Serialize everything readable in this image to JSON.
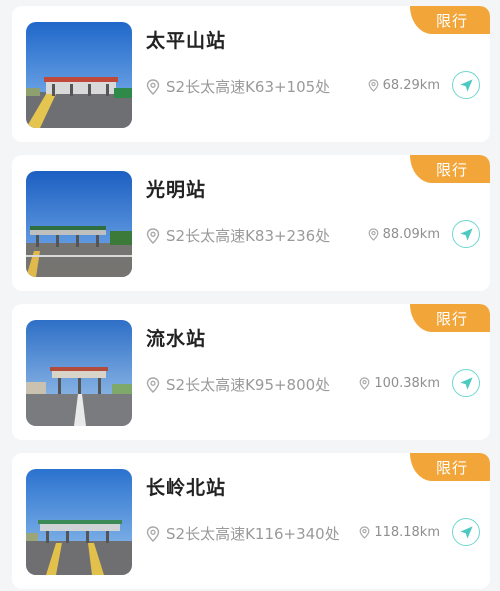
{
  "stations": [
    {
      "name": "太平山站",
      "location": "S2长太高速K63+105处",
      "distance": "68.29km",
      "tag": "限行"
    },
    {
      "name": "光明站",
      "location": "S2长太高速K83+236处",
      "distance": "88.09km",
      "tag": "限行"
    },
    {
      "name": "流水站",
      "location": "S2长太高速K95+800处",
      "distance": "100.38km",
      "tag": "限行"
    },
    {
      "name": "长岭北站",
      "location": "S2长太高速K116+340处",
      "distance": "118.18km",
      "tag": "限行"
    }
  ],
  "colors": {
    "tag_bg": "#f2a63a",
    "nav_accent": "#4cc9c0",
    "title": "#222222",
    "meta": "#9a9a9a",
    "page_bg": "#f4f5f7"
  },
  "icons": {
    "thumbnail": "toll-station-photo",
    "location": "location-pin-icon",
    "distance": "distance-pin-icon",
    "navigate": "navigate-arrow-icon"
  }
}
